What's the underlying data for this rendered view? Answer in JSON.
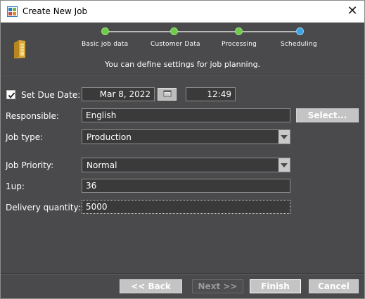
{
  "window": {
    "title": "Create New Job",
    "close_glyph": "✕"
  },
  "steps": [
    {
      "label": "Basic job data",
      "state": "done"
    },
    {
      "label": "Customer Data",
      "state": "done"
    },
    {
      "label": "Processing",
      "state": "done"
    },
    {
      "label": "Scheduling",
      "state": "current"
    }
  ],
  "subtitle": "You can define settings for job planning.",
  "form": {
    "due_date": {
      "checkbox_label": "Set Due Date:",
      "checked": true,
      "date": "Mar 8, 2022",
      "time": "12:49"
    },
    "responsible": {
      "label": "Responsible:",
      "value": "English",
      "select_button": "Select..."
    },
    "job_type": {
      "label": "Job type:",
      "value": "Production"
    },
    "job_priority": {
      "label": "Job Priority:",
      "value": "Normal"
    },
    "one_up": {
      "label": "1up:",
      "value": "36"
    },
    "delivery_quantity": {
      "label": "Delivery quantity:",
      "value": "5000"
    }
  },
  "footer": {
    "back": "<< Back",
    "next": "Next >>",
    "finish": "Finish",
    "cancel": "Cancel"
  },
  "colors": {
    "background": "#4a4a4c",
    "step_done": "#6fc94a",
    "step_current": "#3aa3e0"
  },
  "icons": [
    "app-icon",
    "close-icon",
    "folder-icon",
    "checkbox-check-icon",
    "calendar-icon",
    "dropdown-arrow-icon"
  ]
}
